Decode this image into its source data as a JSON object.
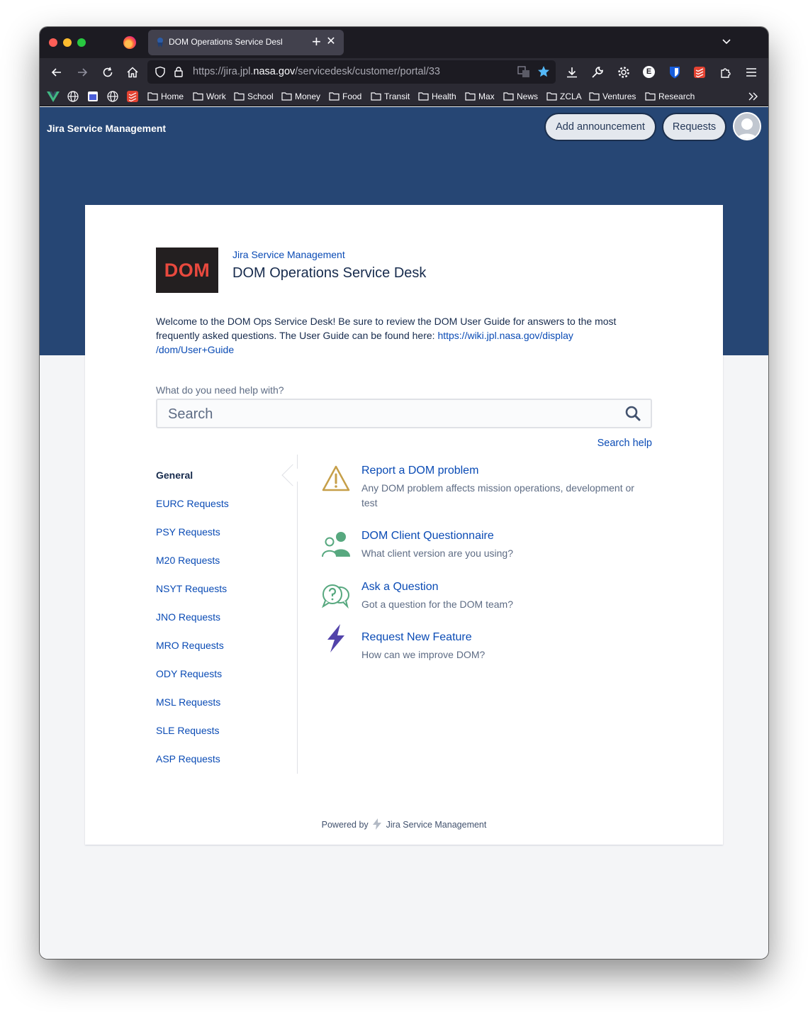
{
  "browser": {
    "tab_title": "DOM Operations Service Desk - Jira",
    "url_prefix": "https://jira.jpl.",
    "url_host": "nasa.gov",
    "url_path": "/servicedesk/customer/portal/33",
    "bookmarks": [
      "Home",
      "Work",
      "School",
      "Money",
      "Food",
      "Transit",
      "Health",
      "Max",
      "News",
      "ZCLA",
      "Ventures",
      "Research"
    ],
    "bookmark_icons": [
      "vue-icon",
      "globe-icon",
      "calendar-icon",
      "globe-icon",
      "todoist-icon"
    ]
  },
  "header": {
    "brand": "Jira Service Management",
    "add_announcement": "Add announcement",
    "requests": "Requests"
  },
  "portal": {
    "logo_text": "DOM",
    "breadcrumb": "Jira Service Management",
    "title": "DOM Operations Service Desk",
    "welcome_text": "Welcome to the DOM Ops Service Desk! Be sure to review the DOM User Guide for answers to the most frequently asked questions. The User Guide can be found here: ",
    "welcome_link": "https://wiki.jpl.nasa.gov/display/dom/User+Guide",
    "welcome_link_line1": "https://wiki.jpl.nasa.gov/display",
    "welcome_link_line2": "/dom/User+Guide"
  },
  "search": {
    "label": "What do you need help with?",
    "placeholder": "Search",
    "help": "Search help"
  },
  "groups": [
    "General",
    "EURC Requests",
    "PSY Requests",
    "M20 Requests",
    "NSYT Requests",
    "JNO Requests",
    "MRO Requests",
    "ODY Requests",
    "MSL Requests",
    "SLE Requests",
    "ASP Requests"
  ],
  "request_types": [
    {
      "title": "Report a DOM problem",
      "desc": "Any DOM problem affects mission operations, development or test",
      "icon": "warning-icon"
    },
    {
      "title": "DOM Client Questionnaire",
      "desc": "What client version are you using?",
      "icon": "users-icon"
    },
    {
      "title": "Ask a Question",
      "desc": "Got a question for the DOM team?",
      "icon": "question-bubbles-icon"
    },
    {
      "title": "Request New Feature",
      "desc": "How can we improve DOM?",
      "icon": "lightning-icon"
    }
  ],
  "footer": {
    "powered_by": "Powered by",
    "product": "Jira Service Management"
  },
  "colors": {
    "hero": "#264674",
    "link": "#0a4bb5",
    "text": "#172b4d",
    "muted": "#5e6c84",
    "logo_bg": "#231f20",
    "logo_fg": "#e8493e"
  }
}
